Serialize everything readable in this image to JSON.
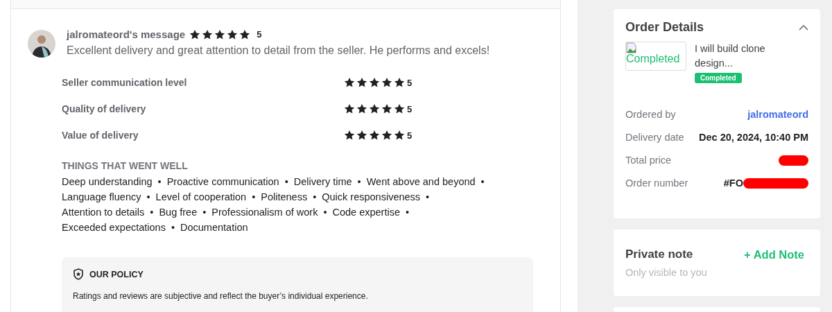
{
  "review": {
    "author_message": "jalromateord's message",
    "stars": 5,
    "score": "5",
    "text": "Excellent delivery and great attention to detail from the seller. He performs and excels!"
  },
  "ratings": [
    {
      "label": "Seller communication level",
      "stars": 5,
      "score": "5"
    },
    {
      "label": "Quality of delivery",
      "stars": 5,
      "score": "5"
    },
    {
      "label": "Value of delivery",
      "stars": 5,
      "score": "5"
    }
  ],
  "went_well": {
    "title": "THINGS THAT WENT WELL",
    "separator": "•",
    "tags": [
      "Deep understanding",
      "Proactive communication",
      "Delivery time",
      "Went above and beyond",
      "Language fluency",
      "Level of cooperation",
      "Politeness",
      "Quick responsiveness",
      "Attention to details",
      "Bug free",
      "Professionalism of work",
      "Code expertise",
      "Exceeded expectations",
      "Documentation"
    ]
  },
  "policy": {
    "title": "OUR POLICY",
    "text": "Ratings and reviews are subjective and reflect the buyer’s individual experience."
  },
  "order_details": {
    "title": "Order Details",
    "expanded": true,
    "image_alt": "Completed",
    "gig_title": "I will build clone design...",
    "status": "Completed",
    "fields": [
      {
        "label": "Ordered by",
        "value": "jalromateord",
        "kind": "link"
      },
      {
        "label": "Delivery date",
        "value": "Dec 20, 2024, 10:40 PM",
        "kind": "text"
      },
      {
        "label": "Total price",
        "kind": "redacted"
      },
      {
        "label": "Order number",
        "value": "#FO",
        "kind": "partly_redacted"
      }
    ]
  },
  "private_note": {
    "title": "Private note",
    "action": "+ Add Note",
    "hint": "Only visible to you"
  }
}
